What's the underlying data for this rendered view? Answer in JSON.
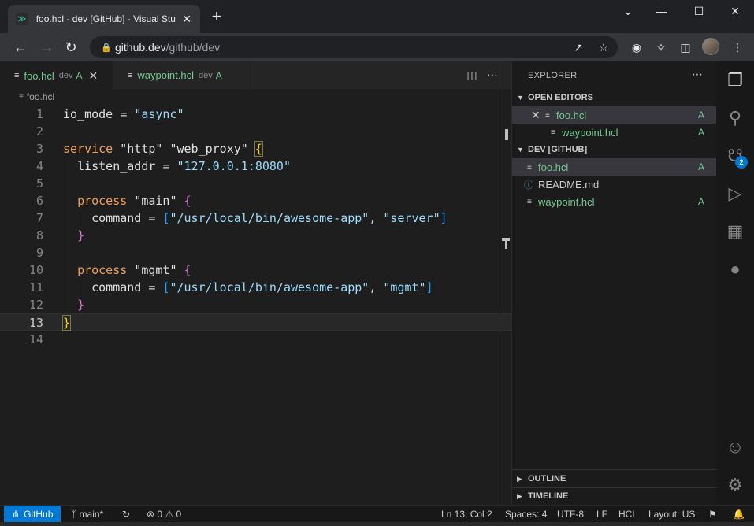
{
  "browser": {
    "tab_title": "foo.hcl - dev [GitHub] - Visual Studio Code",
    "url_host": "github.dev",
    "url_path": "/github/dev"
  },
  "editor": {
    "tabs": [
      {
        "name": "foo.hcl",
        "desc": "dev",
        "status": "A"
      },
      {
        "name": "waypoint.hcl",
        "desc": "dev",
        "status": "A"
      }
    ],
    "breadcrumb": "foo.hcl",
    "current_line": 13,
    "lines": [
      {
        "n": "1"
      },
      {
        "n": "2"
      },
      {
        "n": "3"
      },
      {
        "n": "4"
      },
      {
        "n": "5"
      },
      {
        "n": "6"
      },
      {
        "n": "7"
      },
      {
        "n": "8"
      },
      {
        "n": "9"
      },
      {
        "n": "10"
      },
      {
        "n": "11"
      },
      {
        "n": "12"
      },
      {
        "n": "13"
      },
      {
        "n": "14"
      }
    ],
    "code": {
      "l1_id": "io_mode",
      "l1_eq": "=",
      "l1_str": "\"async\"",
      "l3_kw": "service",
      "l3_s1": "\"http\"",
      "l3_s2": "\"web_proxy\"",
      "l3_br": "{",
      "l4_id": "listen_addr",
      "l4_eq": "=",
      "l4_str": "\"127.0.0.1:8080\"",
      "l6_kw": "process",
      "l6_s": "\"main\"",
      "l6_br": "{",
      "l7_id": "command",
      "l7_eq": "=",
      "l7_ob": "[",
      "l7_s1": "\"/usr/local/bin/awesome-app\"",
      "l7_c": ",",
      "l7_s2": "\"server\"",
      "l7_cb": "]",
      "l8_br": "}",
      "l10_kw": "process",
      "l10_s": "\"mgmt\"",
      "l10_br": "{",
      "l11_id": "command",
      "l11_eq": "=",
      "l11_ob": "[",
      "l11_s1": "\"/usr/local/bin/awesome-app\"",
      "l11_c": ",",
      "l11_s2": "\"mgmt\"",
      "l11_cb": "]",
      "l12_br": "}",
      "l13_br": "}"
    }
  },
  "sidebar": {
    "title": "EXPLORER",
    "open_editors_label": "OPEN EDITORS",
    "open_editors": [
      {
        "name": "foo.hcl",
        "status": "A"
      },
      {
        "name": "waypoint.hcl",
        "status": "A"
      }
    ],
    "repo_label": "DEV [GITHUB]",
    "files": [
      {
        "name": "foo.hcl",
        "status": "A"
      },
      {
        "name": "README.md",
        "status": ""
      },
      {
        "name": "waypoint.hcl",
        "status": "A"
      }
    ],
    "outline_label": "OUTLINE",
    "timeline_label": "TIMELINE"
  },
  "activity": {
    "scm_badge": "2"
  },
  "status": {
    "remote": "GitHub",
    "branch": "main*",
    "errors": "0",
    "warnings": "0",
    "position": "Ln 13, Col 2",
    "spaces": "Spaces: 4",
    "encoding": "UTF-8",
    "eol": "LF",
    "language": "HCL",
    "layout": "Layout: US"
  },
  "colors": {
    "accent": "#0078d4",
    "git_added": "#73c991"
  }
}
